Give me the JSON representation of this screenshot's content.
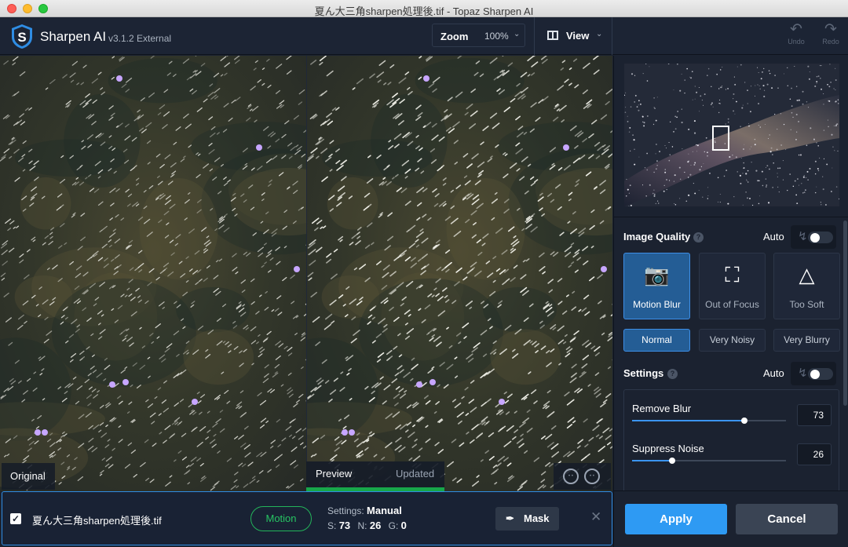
{
  "window": {
    "title": "夏ん大三角sharpen処理後.tif - Topaz Sharpen AI"
  },
  "app": {
    "name": "Sharpen AI",
    "version": "v3.1.2 External",
    "logo_icon": "topaz-shield-logo-icon"
  },
  "toolbar": {
    "zoom_label": "Zoom",
    "zoom_value": "100%",
    "view_label": "View",
    "undo_label": "Undo",
    "redo_label": "Redo"
  },
  "viewer": {
    "original_label": "Original",
    "preview_label": "Preview",
    "updated_label": "Updated",
    "preview_progress": 1.0
  },
  "file_bar": {
    "checked": true,
    "filename": "夏ん大三角sharpen処理後.tif",
    "mode_pill": "Motion",
    "settings_prefix": "Settings:",
    "settings_value": "Manual",
    "s_label": "S:",
    "s_value": "73",
    "n_label": "N:",
    "n_value": "26",
    "g_label": "G:",
    "g_value": "0",
    "mask_label": "Mask"
  },
  "panel": {
    "image_quality_label": "Image Quality",
    "auto_label": "Auto",
    "modes": [
      {
        "label": "Motion Blur",
        "icon": "motion-camera-icon",
        "active": true
      },
      {
        "label": "Out of Focus",
        "icon": "focus-person-icon",
        "active": false
      },
      {
        "label": "Too Soft",
        "icon": "soft-triangle-icon",
        "active": false
      }
    ],
    "levels": [
      {
        "label": "Normal",
        "active": true
      },
      {
        "label": "Very Noisy",
        "active": false
      },
      {
        "label": "Very Blurry",
        "active": false
      }
    ],
    "settings_label": "Settings",
    "sliders": [
      {
        "label": "Remove Blur",
        "value": "73",
        "fraction": 0.73
      },
      {
        "label": "Suppress Noise",
        "value": "26",
        "fraction": 0.26
      }
    ],
    "apply_label": "Apply",
    "cancel_label": "Cancel"
  },
  "colors": {
    "accent": "#2e9af3",
    "active_card": "#245d95",
    "motion_green": "#23b45a",
    "panel_bg": "#1b2230"
  }
}
